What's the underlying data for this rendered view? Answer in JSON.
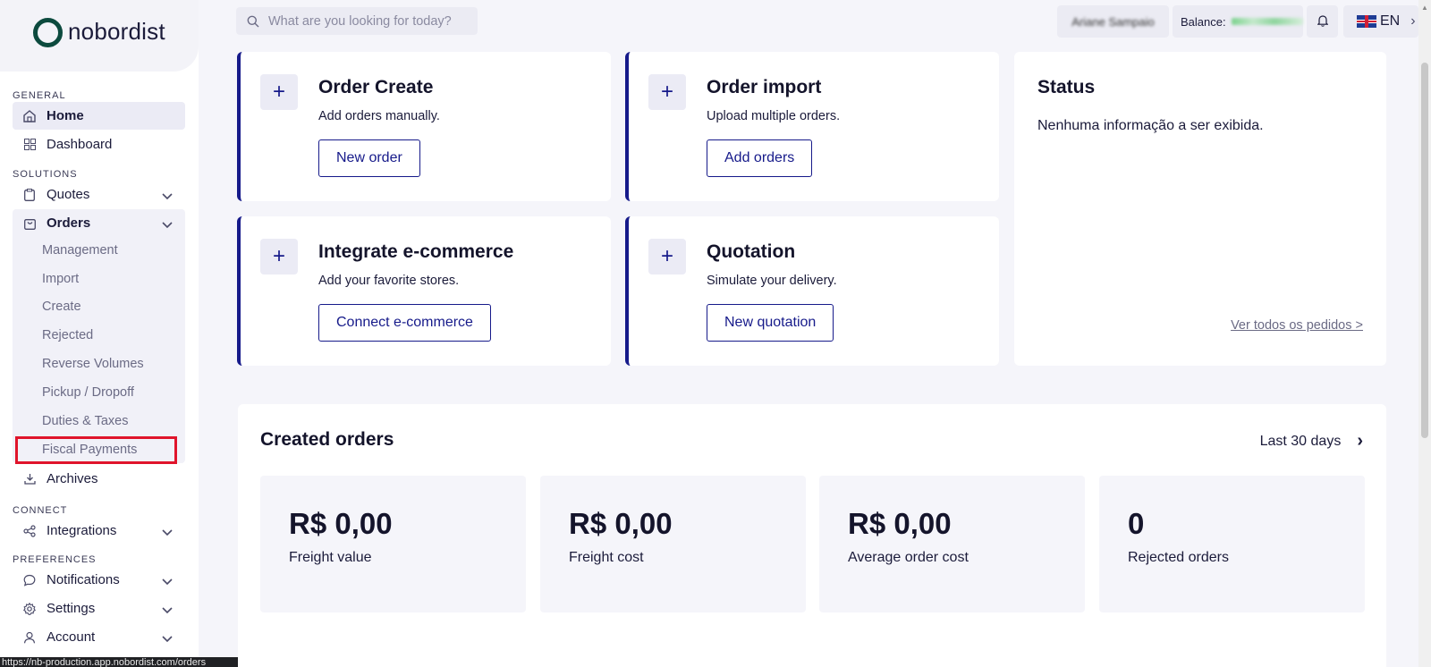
{
  "brand": {
    "name": "nobordist"
  },
  "search": {
    "placeholder": "What are you looking for today?"
  },
  "topbar": {
    "user_name": "Ariane Sampaio",
    "balance_label": "Balance:",
    "language": "EN"
  },
  "sidebar": {
    "general_title": "GENERAL",
    "home": "Home",
    "dashboard": "Dashboard",
    "solutions_title": "SOLUTIONS",
    "quotes": "Quotes",
    "orders": "Orders",
    "orders_sub": [
      "Management",
      "Import",
      "Create",
      "Rejected",
      "Reverse Volumes",
      "Pickup / Dropoff",
      "Duties & Taxes",
      "Fiscal Payments"
    ],
    "archives": "Archives",
    "connect_title": "CONNECT",
    "integrations": "Integrations",
    "preferences_title": "PREFERENCES",
    "notifications": "Notifications",
    "settings": "Settings",
    "account": "Account"
  },
  "status_url": "https://nb-production.app.nobordist.com/orders",
  "cards": [
    {
      "title": "Order Create",
      "subtitle": "Add orders manually.",
      "button": "New order"
    },
    {
      "title": "Order import",
      "subtitle": "Upload multiple orders.",
      "button": "Add orders"
    },
    {
      "title": "Integrate e-commerce",
      "subtitle": "Add your favorite stores.",
      "button": "Connect e-commerce"
    },
    {
      "title": "Quotation",
      "subtitle": "Simulate your delivery.",
      "button": "New quotation"
    }
  ],
  "status": {
    "title": "Status",
    "message": "Nenhuma informação a ser exibida.",
    "link": "Ver todos os pedidos >"
  },
  "created_orders": {
    "title": "Created orders",
    "range": "Last 30 days",
    "metrics": [
      {
        "value": "R$ 0,00",
        "label": "Freight value"
      },
      {
        "value": "R$ 0,00",
        "label": "Freight cost"
      },
      {
        "value": "R$ 0,00",
        "label": "Average order cost"
      },
      {
        "value": "0",
        "label": "Rejected orders"
      }
    ]
  },
  "colors": {
    "accent": "#161a8a",
    "highlight": "#e0142b",
    "logo": "#0c4a3e"
  }
}
